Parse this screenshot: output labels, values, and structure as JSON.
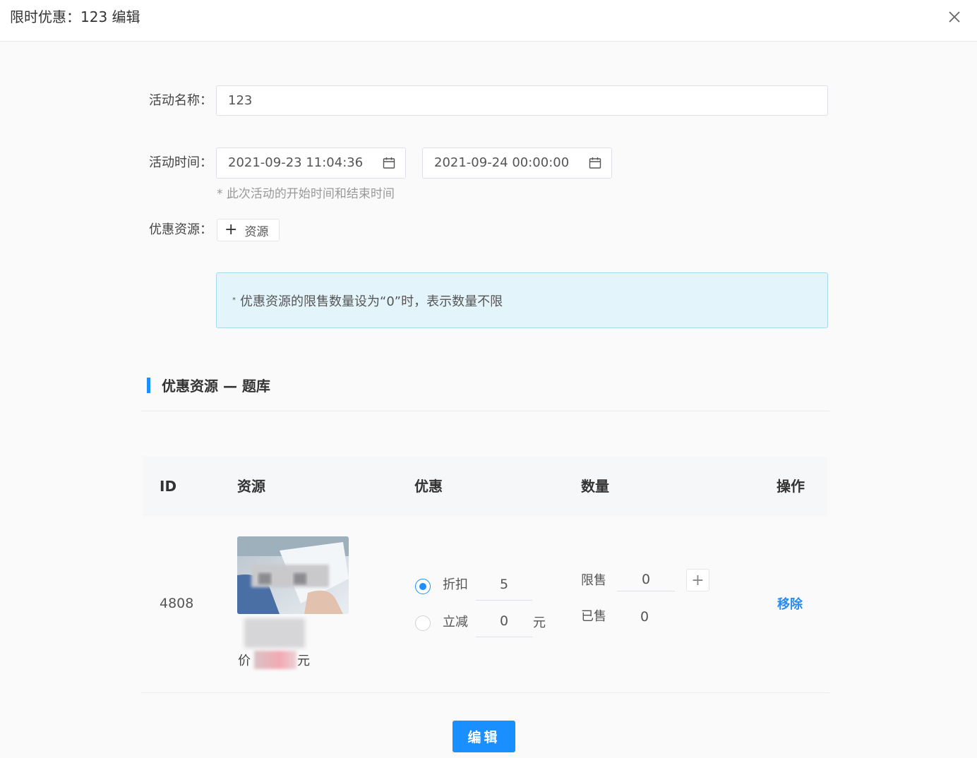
{
  "header": {
    "title": "限时优惠：123 编辑",
    "close_icon": "close-icon"
  },
  "form": {
    "name_label": "活动名称：",
    "name_value": "123",
    "time_label": "活动时间：",
    "start_time": "2021-09-23 11:04:36",
    "end_time": "2021-09-24 00:00:00",
    "time_hint": "* 此次活动的开始时间和结束时间",
    "resource_label": "优惠资源：",
    "add_resource_button": "资源"
  },
  "notice": {
    "text": "优惠资源的限售数量设为“0”时，表示数量不限"
  },
  "section": {
    "title": "优惠资源 — 题库"
  },
  "table": {
    "headers": {
      "id": "ID",
      "resource": "资源",
      "discount": "优惠",
      "quantity": "数量",
      "action": "操作"
    },
    "row": {
      "id": "4808",
      "price_prefix": "价",
      "price_suffix": "元",
      "discount_option": {
        "label": "折扣",
        "value": "5",
        "selected": true
      },
      "reduce_option": {
        "label": "立减",
        "value": "0",
        "unit": "元",
        "selected": false
      },
      "limit_label": "限售",
      "limit_value": "0",
      "sold_label": "已售",
      "sold_value": "0",
      "remove_label": "移除"
    }
  },
  "footer": {
    "edit_button": "编辑"
  },
  "colors": {
    "primary": "#1a8fff",
    "notice_bg": "#e4f4fb",
    "notice_border": "#a7d9ee"
  }
}
